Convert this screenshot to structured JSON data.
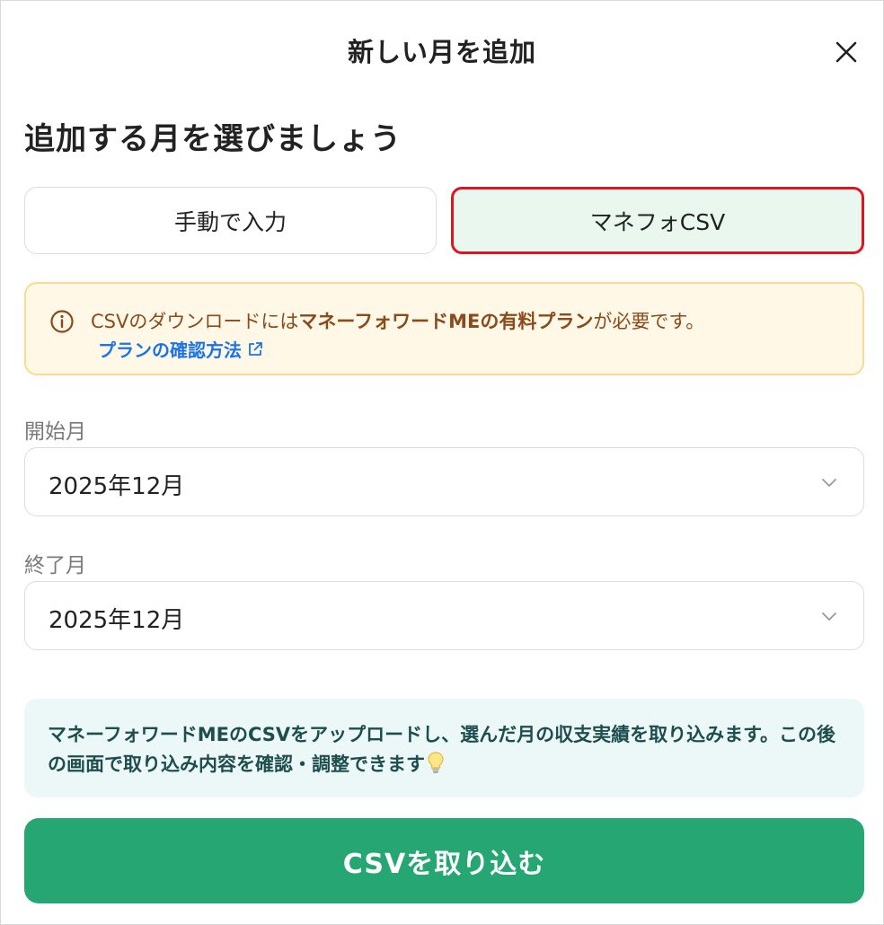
{
  "header": {
    "title": "新しい月を追加",
    "close_icon": "close-icon"
  },
  "heading": "追加する月を選びましょう",
  "tabs": [
    {
      "label": "手動で入力",
      "selected": false
    },
    {
      "label": "マネフォCSV",
      "selected": true
    }
  ],
  "notice": {
    "icon": "info-icon",
    "text_before": "CSVのダウンロードには",
    "text_bold": "マネーフォワードMEの有料プラン",
    "text_after": "が必要です。",
    "link_label": "プランの確認方法",
    "link_icon": "external-link-icon",
    "colors": {
      "background": "#fff8e6",
      "border": "#f6dc92",
      "text": "#8b4a1c",
      "link": "#1a73e8"
    }
  },
  "start_month": {
    "label": "開始月",
    "value": "2025年12月"
  },
  "end_month": {
    "label": "終了月",
    "value": "2025年12月"
  },
  "info": {
    "text": "マネーフォワードMEのCSVをアップロードし、選んだ月の収支実績を取り込みます。この後の画面で取り込み内容を確認・調整できます",
    "icon": "lightbulb-icon"
  },
  "primary_button": {
    "label": "CSVを取り込む",
    "color": "#26a672"
  },
  "colors": {
    "selected_tab_bg": "#e9f7ee",
    "highlight_border": "#e0141e"
  }
}
